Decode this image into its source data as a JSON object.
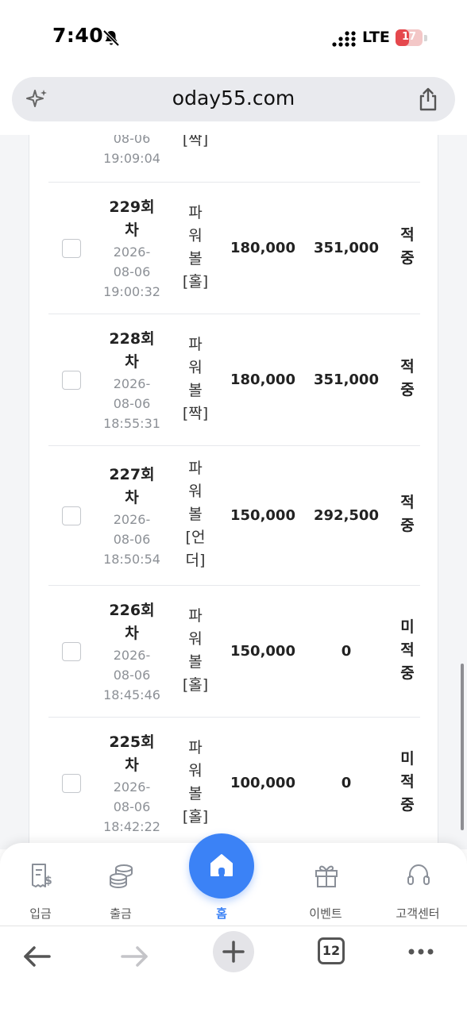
{
  "status_bar": {
    "time": "7:40",
    "network": "LTE",
    "battery": "17",
    "battery_level": 0.17
  },
  "browser": {
    "url": "oday55.com",
    "tab_count": "12"
  },
  "partial_row": {
    "date_line2": "08-06",
    "date_line3": "19:09:04",
    "game_tail": "[짝]"
  },
  "rows": [
    {
      "round_line1": "229회",
      "round_line2": "차",
      "date": [
        "2026-",
        "08-06",
        "19:00:32"
      ],
      "game": [
        "파",
        "워",
        "볼",
        "[홀]"
      ],
      "bet": "180,000",
      "payout": "351,000",
      "result": [
        "적",
        "중"
      ]
    },
    {
      "round_line1": "228회",
      "round_line2": "차",
      "date": [
        "2026-",
        "08-06",
        "18:55:31"
      ],
      "game": [
        "파",
        "워",
        "볼",
        "[짝]"
      ],
      "bet": "180,000",
      "payout": "351,000",
      "result": [
        "적",
        "중"
      ]
    },
    {
      "round_line1": "227회",
      "round_line2": "차",
      "date": [
        "2026-",
        "08-06",
        "18:50:54"
      ],
      "game": [
        "파",
        "워",
        "볼",
        "[언",
        "더]"
      ],
      "bet": "150,000",
      "payout": "292,500",
      "result": [
        "적",
        "중"
      ]
    },
    {
      "round_line1": "226회",
      "round_line2": "차",
      "date": [
        "2026-",
        "08-06",
        "18:45:46"
      ],
      "game": [
        "파",
        "워",
        "볼",
        "[홀]"
      ],
      "bet": "150,000",
      "payout": "0",
      "result": [
        "미",
        "적",
        "중"
      ]
    },
    {
      "round_line1": "225회",
      "round_line2": "차",
      "date": [
        "2026-",
        "08-06",
        "18:42:22"
      ],
      "game": [
        "파",
        "워",
        "볼",
        "[홀]"
      ],
      "bet": "100,000",
      "payout": "0",
      "result": [
        "미",
        "적",
        "중"
      ]
    }
  ],
  "app_nav": {
    "deposit": "입금",
    "withdraw": "출금",
    "home": "홈",
    "event": "이벤트",
    "support": "고객센터"
  },
  "colors": {
    "accent": "#3b82f6",
    "battery_low": "#e5484d"
  }
}
